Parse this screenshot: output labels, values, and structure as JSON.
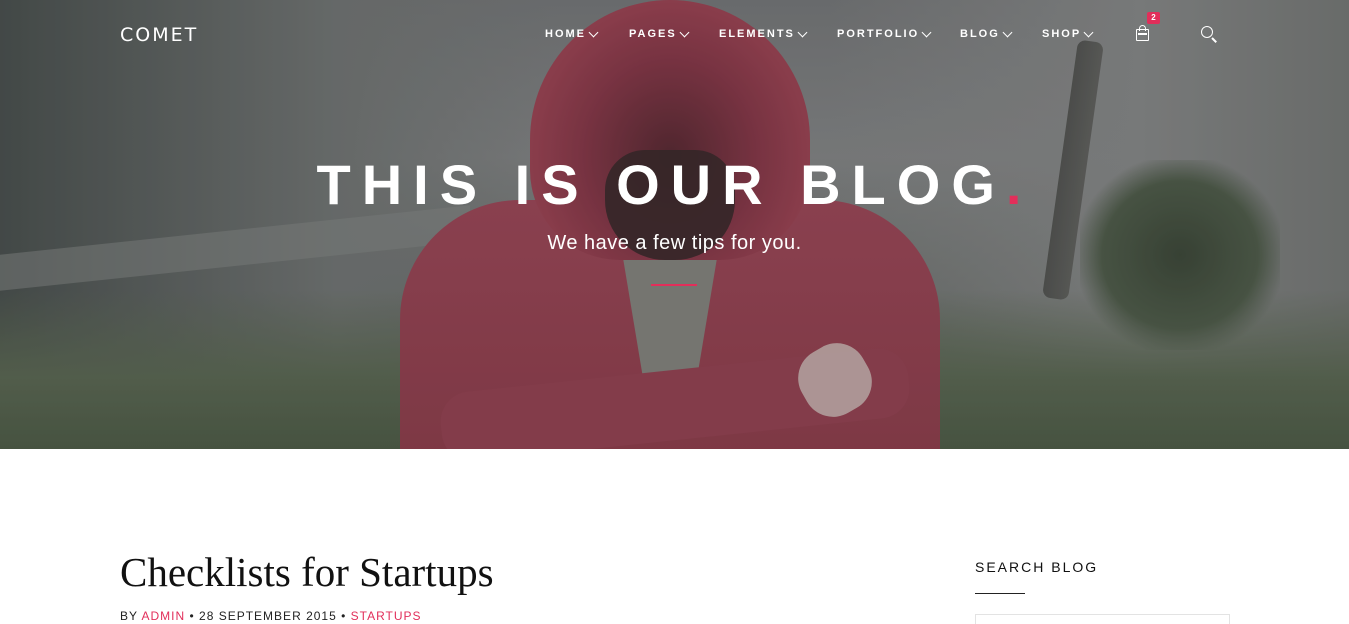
{
  "header": {
    "logo": "COMET",
    "nav": [
      {
        "label": "HOME"
      },
      {
        "label": "PAGES"
      },
      {
        "label": "ELEMENTS"
      },
      {
        "label": "PORTFOLIO"
      },
      {
        "label": "BLOG"
      },
      {
        "label": "SHOP"
      }
    ],
    "cart_count": "2",
    "icons": {
      "cart": "shopping-bag-icon",
      "search": "search-icon",
      "dropdown": "chevron-down-icon"
    }
  },
  "hero": {
    "title": "THIS IS OUR BLOG",
    "title_dot": ".",
    "subtitle": "We have a few tips for you."
  },
  "post": {
    "title": "Checklists for Startups",
    "meta_by": "BY",
    "author": "ADMIN",
    "separator": "•",
    "date": "28 SEPTEMBER 2015",
    "category": "STARTUPS"
  },
  "sidebar": {
    "search_title": "SEARCH BLOG",
    "search_value": ""
  },
  "colors": {
    "accent": "#e22e5a",
    "text": "#111111",
    "white": "#ffffff"
  }
}
